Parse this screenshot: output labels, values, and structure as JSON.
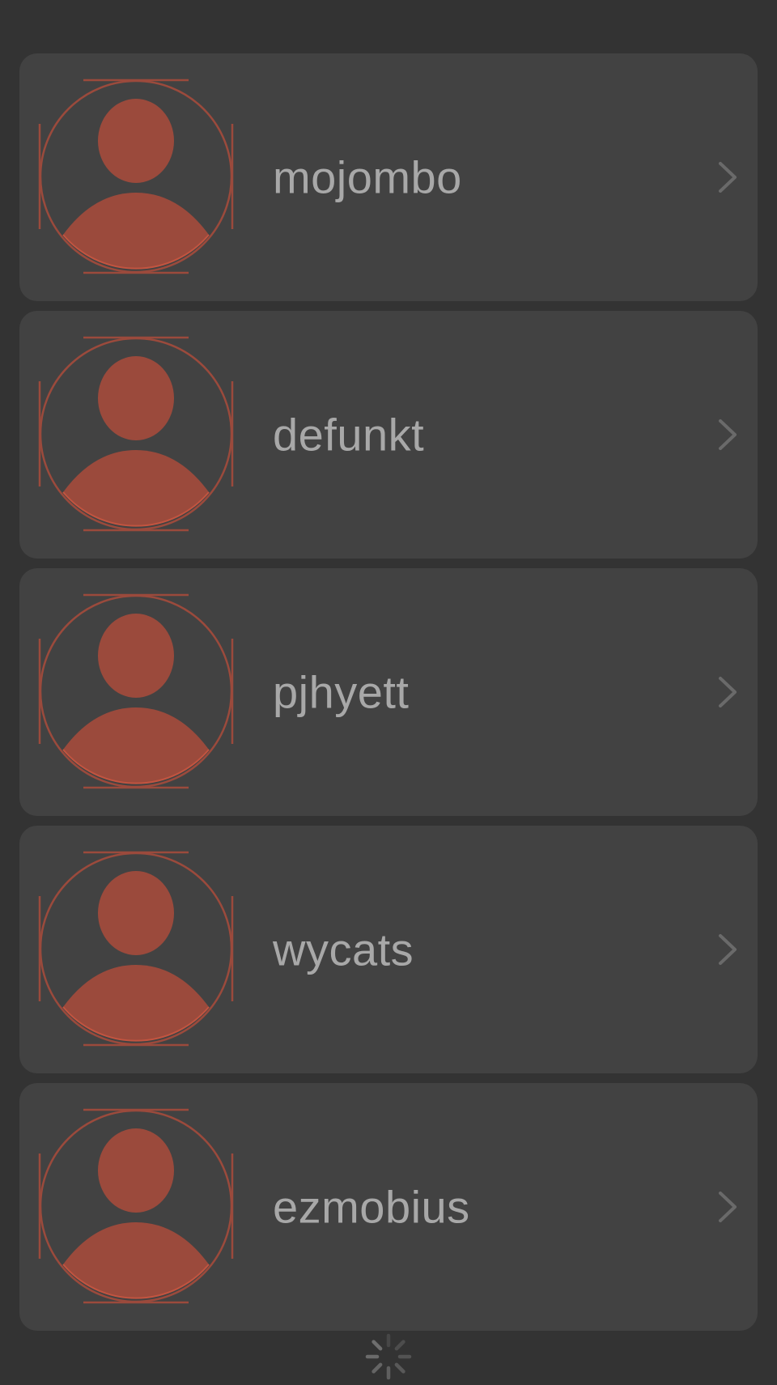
{
  "users": [
    {
      "username": "mojombo",
      "avatar_icon": "person-placeholder-icon",
      "chevron_icon": "chevron-right-icon"
    },
    {
      "username": "defunkt",
      "avatar_icon": "person-placeholder-icon",
      "chevron_icon": "chevron-right-icon"
    },
    {
      "username": "pjhyett",
      "avatar_icon": "person-placeholder-icon",
      "chevron_icon": "chevron-right-icon"
    },
    {
      "username": "wycats",
      "avatar_icon": "person-placeholder-icon",
      "chevron_icon": "chevron-right-icon"
    },
    {
      "username": "ezmobius",
      "avatar_icon": "person-placeholder-icon",
      "chevron_icon": "chevron-right-icon"
    }
  ],
  "loading_indicator": {
    "icon": "loading-spinner-icon"
  },
  "colors": {
    "background": "#333333",
    "card": "#424242",
    "text": "#a8a8a8",
    "avatar_accent": "#9b4a3c",
    "chevron": "#6a6a6a",
    "spinner": "#6e6e6e"
  }
}
